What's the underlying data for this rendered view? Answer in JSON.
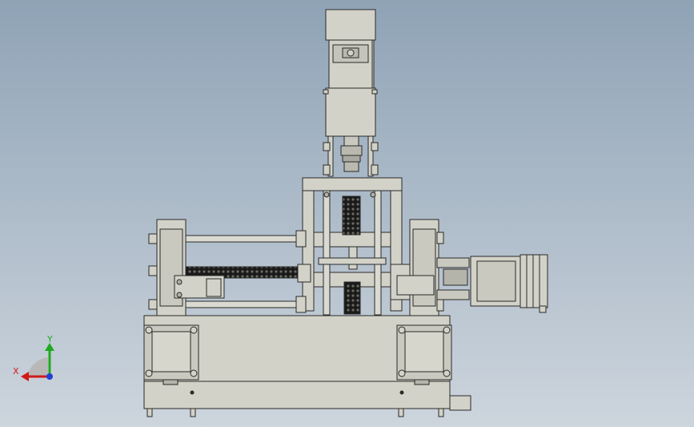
{
  "viewport": {
    "background_top": "#8fa3b6",
    "background_bottom": "#cdd5dd",
    "part_fill": "#d2d2c8",
    "part_stroke": "#2a2a2a",
    "spring_fill": "#1a1a1a"
  },
  "triad": {
    "x_label": "X",
    "y_label": "Y",
    "x_color": "#d11a1a",
    "y_color": "#1faa1f",
    "z_color": "#1f3fd6"
  }
}
